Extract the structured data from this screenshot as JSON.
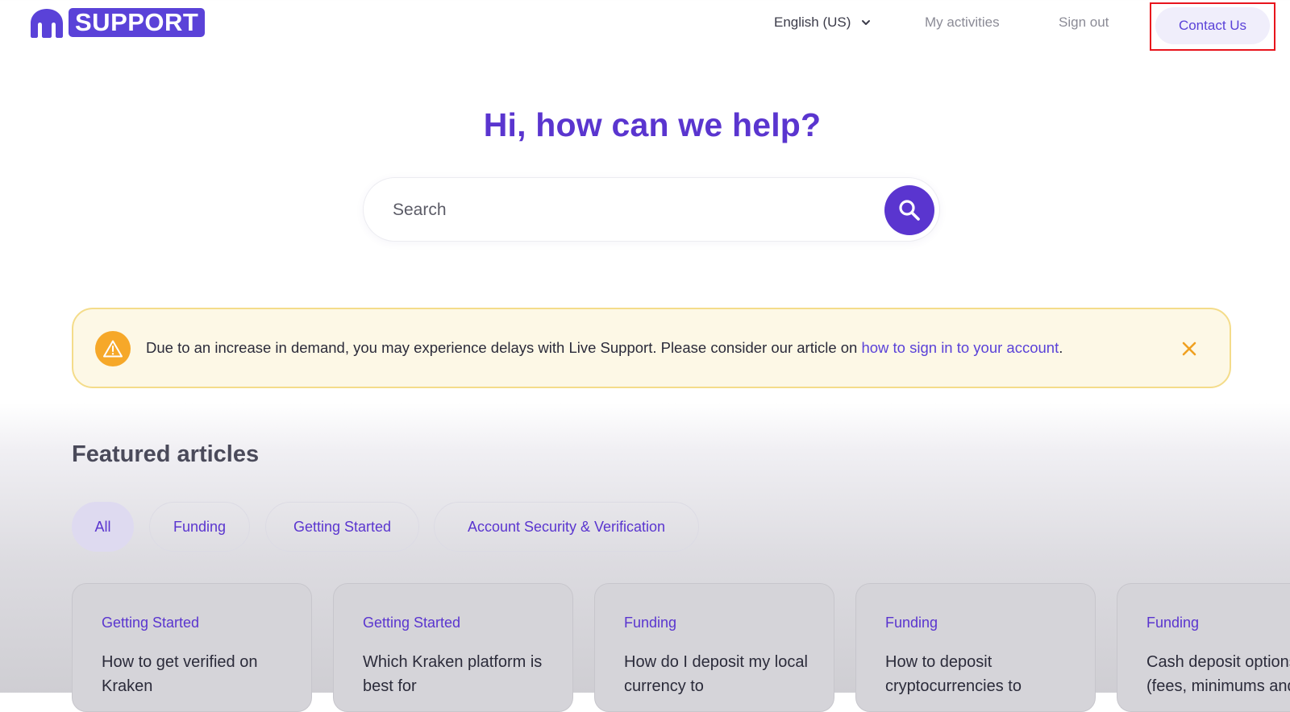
{
  "header": {
    "logo_text": "SUPPORT",
    "language": "English (US)",
    "my_activities": "My activities",
    "sign_out": "Sign out",
    "contact_us": "Contact Us"
  },
  "hero": {
    "title": "Hi, how can we help?",
    "search_placeholder": "Search"
  },
  "alert": {
    "message": "Due to an increase in demand, you may experience delays with Live Support. Please consider our article on ",
    "link_text": "how to sign in to your account",
    "message_end": "."
  },
  "featured": {
    "title": "Featured articles",
    "chips": [
      "All",
      "Funding",
      "Getting Started",
      "Account Security & Verification"
    ],
    "cards": [
      {
        "category": "Getting Started",
        "title": "How to get verified on Kraken"
      },
      {
        "category": "Getting Started",
        "title": "Which Kraken platform is best for"
      },
      {
        "category": "Funding",
        "title": "How do I deposit my local currency to"
      },
      {
        "category": "Funding",
        "title": "How to deposit cryptocurrencies to"
      },
      {
        "category": "Funding",
        "title": "Cash deposit options (fees, minimums and"
      }
    ]
  },
  "colors": {
    "brand": "#5a42d8",
    "brand_dark": "#5a35cf",
    "alert_bg": "#fdf8e6",
    "alert_icon": "#f6a829",
    "highlight_box": "#e8141c"
  }
}
